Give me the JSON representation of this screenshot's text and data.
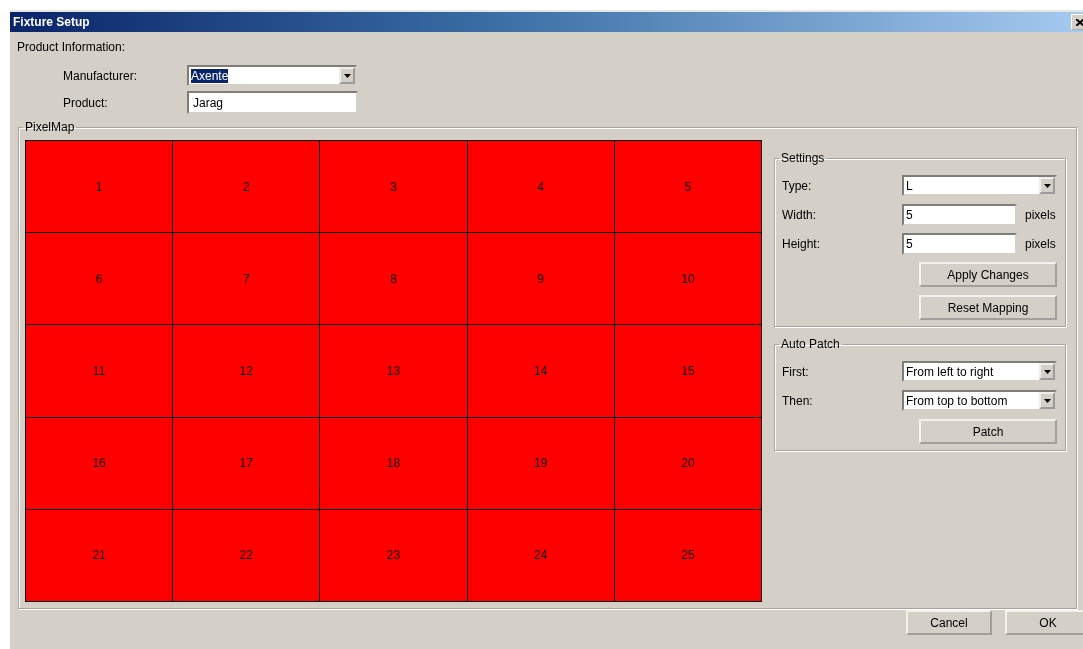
{
  "window": {
    "title": "Fixture Setup"
  },
  "product_information": {
    "label": "Product Information:",
    "manufacturer": {
      "label": "Manufacturer:",
      "value": "Axente",
      "highlighted": true
    },
    "product": {
      "label": "Product:",
      "value": "Jarag"
    }
  },
  "pixel_map": {
    "title": "PixelMap",
    "rows": [
      [
        "1",
        "2",
        "3",
        "4",
        "5"
      ],
      [
        "6",
        "7",
        "8",
        "9",
        "10"
      ],
      [
        "11",
        "12",
        "13",
        "14",
        "15"
      ],
      [
        "16",
        "17",
        "18",
        "19",
        "20"
      ],
      [
        "21",
        "22",
        "23",
        "24",
        "25"
      ]
    ]
  },
  "settings": {
    "title": "Settings",
    "fields": [
      {
        "kind": "combo",
        "label": "Type:",
        "value": "L"
      },
      {
        "kind": "text",
        "label": "Width:",
        "value": "5",
        "unit": "pixels"
      },
      {
        "kind": "text",
        "label": "Height:",
        "value": "5",
        "unit": "pixels"
      }
    ],
    "buttons": [
      "Apply Changes",
      "Reset Mapping"
    ]
  },
  "auto_patch": {
    "title": "Auto Patch",
    "fields": [
      {
        "kind": "combo",
        "label": "First:",
        "value": "From left to right"
      },
      {
        "kind": "combo",
        "label": "Then:",
        "value": "From top to bottom"
      }
    ],
    "buttons": [
      "Patch"
    ]
  },
  "buttons": [
    "Cancel",
    "OK"
  ]
}
